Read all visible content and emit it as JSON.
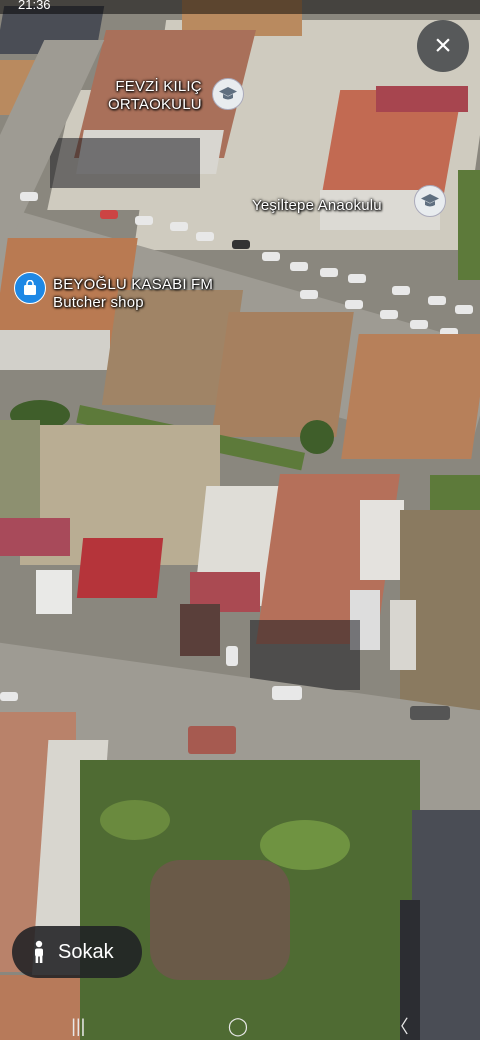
{
  "status_bar": {
    "time": "21:36"
  },
  "close_button": {
    "label": "×"
  },
  "places": [
    {
      "name": "FEVZİ KILIÇ",
      "name_line2": "ORTAOKULU",
      "type_icon": "school-icon"
    },
    {
      "name": "Yeşiltepe Anaokulu",
      "type_icon": "school-icon"
    },
    {
      "name": "BEYOĞLU KASABI FM",
      "category": "Butcher shop",
      "type_icon": "shopping-bag-icon"
    }
  ],
  "mode_chip": {
    "label": "Sokak",
    "icon": "pegman-icon"
  },
  "nav": {
    "recent": "|||",
    "home": "◯",
    "back": "〈"
  },
  "colors": {
    "pin_blue": "#1e88e5",
    "chip_bg": "#202124"
  }
}
